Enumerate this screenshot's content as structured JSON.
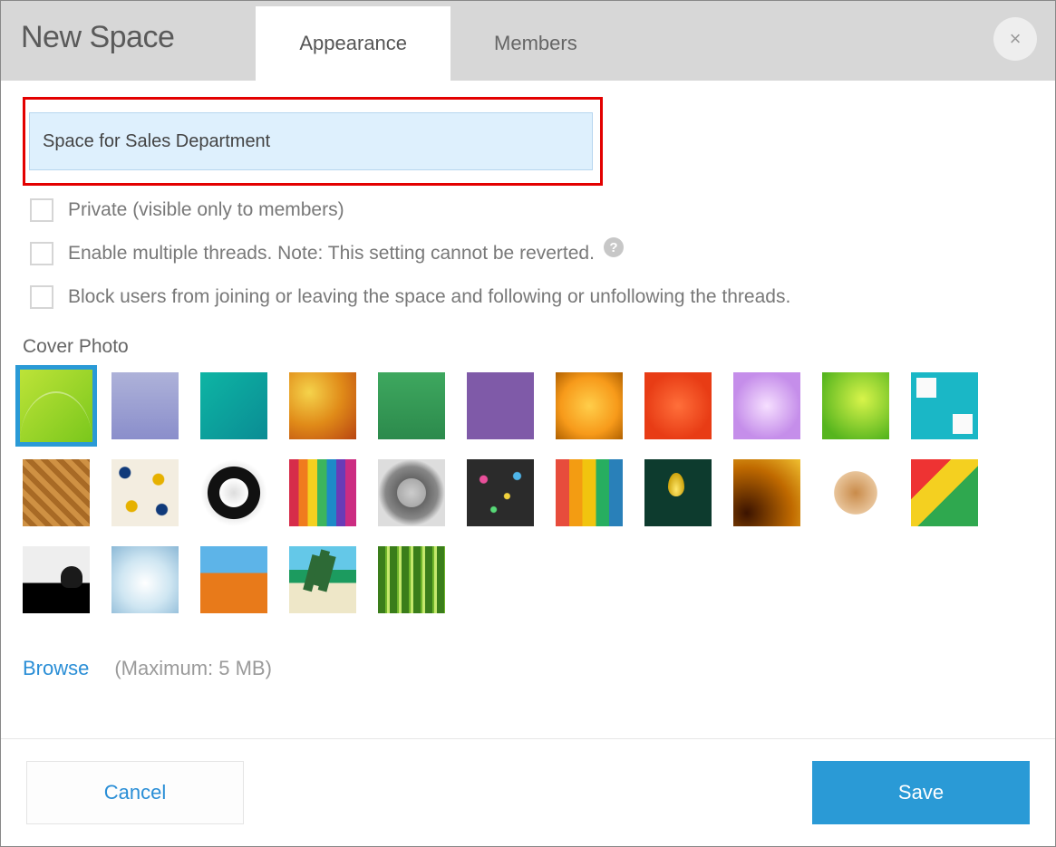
{
  "header": {
    "title": "New Space",
    "close_label": "×"
  },
  "tabs": {
    "appearance": "Appearance",
    "members": "Members",
    "active": "appearance"
  },
  "form": {
    "name_value": "Space for Sales Department",
    "options": {
      "private": {
        "checked": false,
        "label": "Private (visible only to members)"
      },
      "threads": {
        "checked": false,
        "label": "Enable multiple threads. Note: This setting cannot be reverted."
      },
      "block": {
        "checked": false,
        "label": "Block users from joining or leaving the space and following or unfollowing the threads."
      }
    },
    "help_tooltip": "?"
  },
  "cover": {
    "title": "Cover Photo",
    "selected_index": 0,
    "thumbs": [
      "lime-curve",
      "purple-gradient",
      "teal-water",
      "orange-grunge",
      "green-flat",
      "purple-flat",
      "orange-flower",
      "red-carnation",
      "lilac-flower",
      "green-leaf",
      "cyan-cubes",
      "wood-parquet",
      "moroccan-tile",
      "compass",
      "colored-pencils-flat",
      "metal-gear",
      "chalkboard-doodles",
      "smiley-pencils",
      "lightbulb-idea",
      "dark-amber",
      "latte-art",
      "vegetables",
      "french-bulldog",
      "winter-tree",
      "pumpkins",
      "tropical-beach",
      "bamboo"
    ],
    "browse_label": "Browse",
    "max_note": "(Maximum: 5 MB)"
  },
  "footer": {
    "cancel": "Cancel",
    "save": "Save"
  }
}
